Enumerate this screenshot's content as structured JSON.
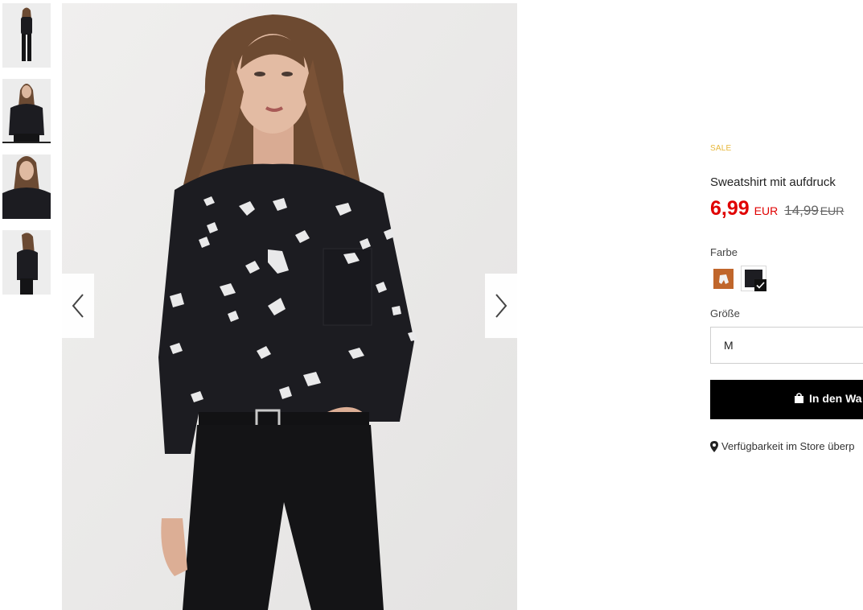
{
  "product": {
    "badge": "SALE",
    "title": "Sweatshirt mit aufdruck",
    "price_now": "6,99",
    "currency": "EUR",
    "price_old": "14,99",
    "colors": {
      "accent_sale": "#e7b73a",
      "price_red": "#e00000"
    }
  },
  "color_picker": {
    "label": "Farbe",
    "options": [
      {
        "name": "orange-print",
        "color": "#c0662b"
      },
      {
        "name": "black",
        "color": "#1d1d22",
        "selected": true
      }
    ]
  },
  "size_picker": {
    "label": "Größe",
    "selected": "M"
  },
  "cart_button": {
    "label": "In den Wa",
    "icon": "shopping-bag-icon"
  },
  "store_link": {
    "label": "Verfügbarkeit im Store überp",
    "icon": "map-pin-icon"
  },
  "gallery": {
    "thumbnail_count": 4,
    "active_thumbnail": 2,
    "prev_icon": "chevron-left-icon",
    "next_icon": "chevron-right-icon"
  }
}
